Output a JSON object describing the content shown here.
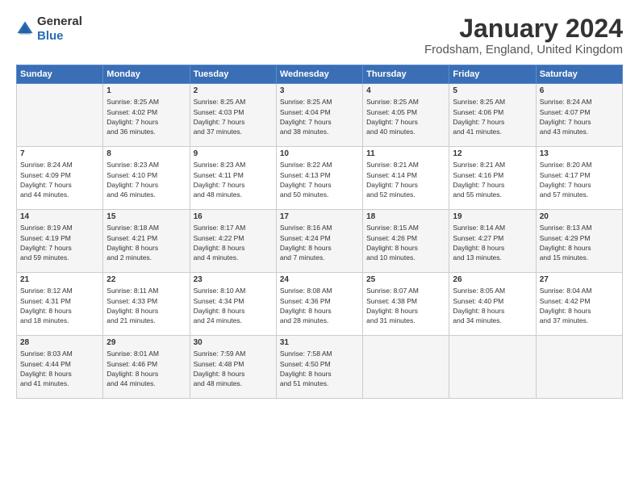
{
  "header": {
    "logo_general": "General",
    "logo_blue": "Blue",
    "title": "January 2024",
    "location": "Frodsham, England, United Kingdom"
  },
  "weekdays": [
    "Sunday",
    "Monday",
    "Tuesday",
    "Wednesday",
    "Thursday",
    "Friday",
    "Saturday"
  ],
  "rows": [
    [
      {
        "day": "",
        "lines": []
      },
      {
        "day": "1",
        "lines": [
          "Sunrise: 8:25 AM",
          "Sunset: 4:02 PM",
          "Daylight: 7 hours",
          "and 36 minutes."
        ]
      },
      {
        "day": "2",
        "lines": [
          "Sunrise: 8:25 AM",
          "Sunset: 4:03 PM",
          "Daylight: 7 hours",
          "and 37 minutes."
        ]
      },
      {
        "day": "3",
        "lines": [
          "Sunrise: 8:25 AM",
          "Sunset: 4:04 PM",
          "Daylight: 7 hours",
          "and 38 minutes."
        ]
      },
      {
        "day": "4",
        "lines": [
          "Sunrise: 8:25 AM",
          "Sunset: 4:05 PM",
          "Daylight: 7 hours",
          "and 40 minutes."
        ]
      },
      {
        "day": "5",
        "lines": [
          "Sunrise: 8:25 AM",
          "Sunset: 4:06 PM",
          "Daylight: 7 hours",
          "and 41 minutes."
        ]
      },
      {
        "day": "6",
        "lines": [
          "Sunrise: 8:24 AM",
          "Sunset: 4:07 PM",
          "Daylight: 7 hours",
          "and 43 minutes."
        ]
      }
    ],
    [
      {
        "day": "7",
        "lines": [
          "Sunrise: 8:24 AM",
          "Sunset: 4:09 PM",
          "Daylight: 7 hours",
          "and 44 minutes."
        ]
      },
      {
        "day": "8",
        "lines": [
          "Sunrise: 8:23 AM",
          "Sunset: 4:10 PM",
          "Daylight: 7 hours",
          "and 46 minutes."
        ]
      },
      {
        "day": "9",
        "lines": [
          "Sunrise: 8:23 AM",
          "Sunset: 4:11 PM",
          "Daylight: 7 hours",
          "and 48 minutes."
        ]
      },
      {
        "day": "10",
        "lines": [
          "Sunrise: 8:22 AM",
          "Sunset: 4:13 PM",
          "Daylight: 7 hours",
          "and 50 minutes."
        ]
      },
      {
        "day": "11",
        "lines": [
          "Sunrise: 8:21 AM",
          "Sunset: 4:14 PM",
          "Daylight: 7 hours",
          "and 52 minutes."
        ]
      },
      {
        "day": "12",
        "lines": [
          "Sunrise: 8:21 AM",
          "Sunset: 4:16 PM",
          "Daylight: 7 hours",
          "and 55 minutes."
        ]
      },
      {
        "day": "13",
        "lines": [
          "Sunrise: 8:20 AM",
          "Sunset: 4:17 PM",
          "Daylight: 7 hours",
          "and 57 minutes."
        ]
      }
    ],
    [
      {
        "day": "14",
        "lines": [
          "Sunrise: 8:19 AM",
          "Sunset: 4:19 PM",
          "Daylight: 7 hours",
          "and 59 minutes."
        ]
      },
      {
        "day": "15",
        "lines": [
          "Sunrise: 8:18 AM",
          "Sunset: 4:21 PM",
          "Daylight: 8 hours",
          "and 2 minutes."
        ]
      },
      {
        "day": "16",
        "lines": [
          "Sunrise: 8:17 AM",
          "Sunset: 4:22 PM",
          "Daylight: 8 hours",
          "and 4 minutes."
        ]
      },
      {
        "day": "17",
        "lines": [
          "Sunrise: 8:16 AM",
          "Sunset: 4:24 PM",
          "Daylight: 8 hours",
          "and 7 minutes."
        ]
      },
      {
        "day": "18",
        "lines": [
          "Sunrise: 8:15 AM",
          "Sunset: 4:26 PM",
          "Daylight: 8 hours",
          "and 10 minutes."
        ]
      },
      {
        "day": "19",
        "lines": [
          "Sunrise: 8:14 AM",
          "Sunset: 4:27 PM",
          "Daylight: 8 hours",
          "and 13 minutes."
        ]
      },
      {
        "day": "20",
        "lines": [
          "Sunrise: 8:13 AM",
          "Sunset: 4:29 PM",
          "Daylight: 8 hours",
          "and 15 minutes."
        ]
      }
    ],
    [
      {
        "day": "21",
        "lines": [
          "Sunrise: 8:12 AM",
          "Sunset: 4:31 PM",
          "Daylight: 8 hours",
          "and 18 minutes."
        ]
      },
      {
        "day": "22",
        "lines": [
          "Sunrise: 8:11 AM",
          "Sunset: 4:33 PM",
          "Daylight: 8 hours",
          "and 21 minutes."
        ]
      },
      {
        "day": "23",
        "lines": [
          "Sunrise: 8:10 AM",
          "Sunset: 4:34 PM",
          "Daylight: 8 hours",
          "and 24 minutes."
        ]
      },
      {
        "day": "24",
        "lines": [
          "Sunrise: 8:08 AM",
          "Sunset: 4:36 PM",
          "Daylight: 8 hours",
          "and 28 minutes."
        ]
      },
      {
        "day": "25",
        "lines": [
          "Sunrise: 8:07 AM",
          "Sunset: 4:38 PM",
          "Daylight: 8 hours",
          "and 31 minutes."
        ]
      },
      {
        "day": "26",
        "lines": [
          "Sunrise: 8:05 AM",
          "Sunset: 4:40 PM",
          "Daylight: 8 hours",
          "and 34 minutes."
        ]
      },
      {
        "day": "27",
        "lines": [
          "Sunrise: 8:04 AM",
          "Sunset: 4:42 PM",
          "Daylight: 8 hours",
          "and 37 minutes."
        ]
      }
    ],
    [
      {
        "day": "28",
        "lines": [
          "Sunrise: 8:03 AM",
          "Sunset: 4:44 PM",
          "Daylight: 8 hours",
          "and 41 minutes."
        ]
      },
      {
        "day": "29",
        "lines": [
          "Sunrise: 8:01 AM",
          "Sunset: 4:46 PM",
          "Daylight: 8 hours",
          "and 44 minutes."
        ]
      },
      {
        "day": "30",
        "lines": [
          "Sunrise: 7:59 AM",
          "Sunset: 4:48 PM",
          "Daylight: 8 hours",
          "and 48 minutes."
        ]
      },
      {
        "day": "31",
        "lines": [
          "Sunrise: 7:58 AM",
          "Sunset: 4:50 PM",
          "Daylight: 8 hours",
          "and 51 minutes."
        ]
      },
      {
        "day": "",
        "lines": []
      },
      {
        "day": "",
        "lines": []
      },
      {
        "day": "",
        "lines": []
      }
    ]
  ]
}
